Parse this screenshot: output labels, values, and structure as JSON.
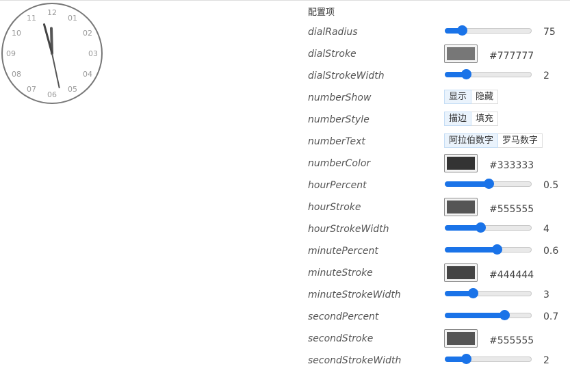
{
  "clock": {
    "numbers": [
      "12",
      "01",
      "02",
      "03",
      "04",
      "05",
      "06",
      "07",
      "08",
      "09",
      "10",
      "11"
    ],
    "dial_color": "#777777",
    "number_color": "#999999",
    "hour_color": "#555555",
    "minute_color": "#444444",
    "second_color": "#555555",
    "time": {
      "hour": 11,
      "minute": 57,
      "second": 28
    }
  },
  "panel": {
    "title": "配置项",
    "rows": {
      "dialRadius": {
        "label": "dialRadius",
        "value": "75",
        "level": 0.19
      },
      "dialStroke": {
        "label": "dialStroke",
        "hex": "#777777",
        "color": "#777777"
      },
      "dialStrokeWidth": {
        "label": "dialStrokeWidth",
        "value": "2",
        "level": 0.24
      },
      "numberShow": {
        "label": "numberShow",
        "options": [
          "显示",
          "隐藏"
        ],
        "selected": 0
      },
      "numberStyle": {
        "label": "numberStyle",
        "options": [
          "描边",
          "填充"
        ],
        "selected": 0
      },
      "numberText": {
        "label": "numberText",
        "options": [
          "阿拉伯数字",
          "罗马数字"
        ],
        "selected": 0
      },
      "numberColor": {
        "label": "numberColor",
        "hex": "#333333",
        "color": "#333333"
      },
      "hourPercent": {
        "label": "hourPercent",
        "value": "0.5",
        "level": 0.5
      },
      "hourStroke": {
        "label": "hourStroke",
        "hex": "#555555",
        "color": "#555555"
      },
      "hourStrokeWidth": {
        "label": "hourStrokeWidth",
        "value": "4",
        "level": 0.41
      },
      "minutePercent": {
        "label": "minutePercent",
        "value": "0.6",
        "level": 0.6
      },
      "minuteStroke": {
        "label": "minuteStroke",
        "hex": "#444444",
        "color": "#444444"
      },
      "minuteStrokeWidth": {
        "label": "minuteStrokeWidth",
        "value": "3",
        "level": 0.32
      },
      "secondPercent": {
        "label": "secondPercent",
        "value": "0.7",
        "level": 0.69
      },
      "secondStroke": {
        "label": "secondStroke",
        "hex": "#555555",
        "color": "#555555"
      },
      "secondStrokeWidth": {
        "label": "secondStrokeWidth",
        "value": "2",
        "level": 0.24
      }
    }
  }
}
